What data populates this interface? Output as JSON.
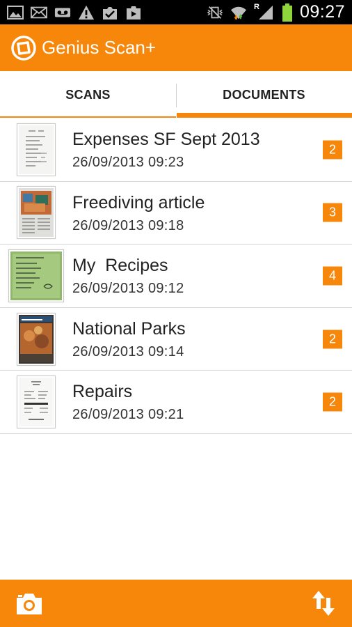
{
  "status_bar": {
    "time": "09:27",
    "left_icons": [
      "gallery-icon",
      "email-icon",
      "voicemail-icon",
      "warning-icon",
      "task-check-icon",
      "play-store-icon"
    ],
    "right_icons": [
      "vibrate-mute-icon",
      "wifi-icon",
      "roaming-signal-icon",
      "battery-icon"
    ],
    "roaming_label": "R"
  },
  "app_bar": {
    "title": "Genius Scan+"
  },
  "tabs": [
    {
      "label": "SCANS",
      "selected": false
    },
    {
      "label": "DOCUMENTS",
      "selected": true
    }
  ],
  "documents": [
    {
      "title": "Expenses SF Sept 2013",
      "date": "26/09/2013 09:23",
      "pages": "2",
      "thumbnail": "receipt-thumbnail"
    },
    {
      "title": "Freediving article",
      "date": "26/09/2013 09:18",
      "pages": "3",
      "thumbnail": "article-thumbnail"
    },
    {
      "title": "My  Recipes",
      "date": "26/09/2013 09:12",
      "pages": "4",
      "thumbnail": "recipe-thumbnail"
    },
    {
      "title": "National Parks",
      "date": "26/09/2013 09:14",
      "pages": "2",
      "thumbnail": "magazine-thumbnail"
    },
    {
      "title": "Repairs",
      "date": "26/09/2013 09:21",
      "pages": "2",
      "thumbnail": "invoice-thumbnail"
    }
  ],
  "bottom_bar": {
    "left_icon": "camera-icon",
    "right_icon": "sort-icon"
  },
  "colors": {
    "accent": "#f7870b",
    "status_bar": "#000000",
    "background": "#ffffff",
    "text": "#222222",
    "divider": "#d6d6d6"
  }
}
